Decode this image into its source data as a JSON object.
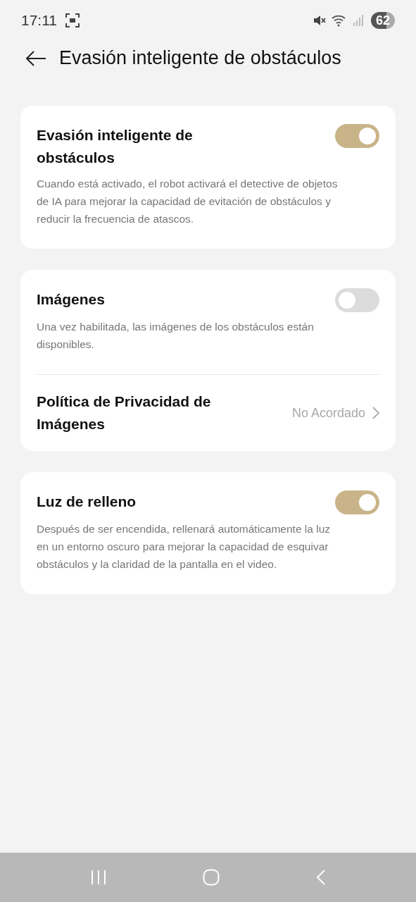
{
  "status_bar": {
    "time": "17:11",
    "battery": "62"
  },
  "header": {
    "title": "Evasión inteligente de obstáculos"
  },
  "cards": [
    {
      "rows": [
        {
          "kind": "toggle",
          "title": "Evasión inteligente de obstáculos",
          "description": "Cuando está activado, el robot activará el detective de objetos de IA para mejorar la capacidad de evitación de obstáculos y reducir la frecuencia de atascos.",
          "on": true
        }
      ]
    },
    {
      "rows": [
        {
          "kind": "toggle",
          "title": "Imágenes",
          "description": "Una vez habilitada, las imágenes de los obstáculos están disponibles.",
          "on": false
        },
        {
          "kind": "link",
          "title": "Política de Privacidad de Imágenes",
          "value": "No Acordado"
        }
      ]
    },
    {
      "rows": [
        {
          "kind": "toggle",
          "title": "Luz de relleno",
          "description": "Después de ser encendida, rellenará automáticamente la luz en un entorno oscuro para mejorar la capacidad de esquivar obstáculos y la claridad de la pantalla en el video.",
          "on": true
        }
      ]
    }
  ]
}
